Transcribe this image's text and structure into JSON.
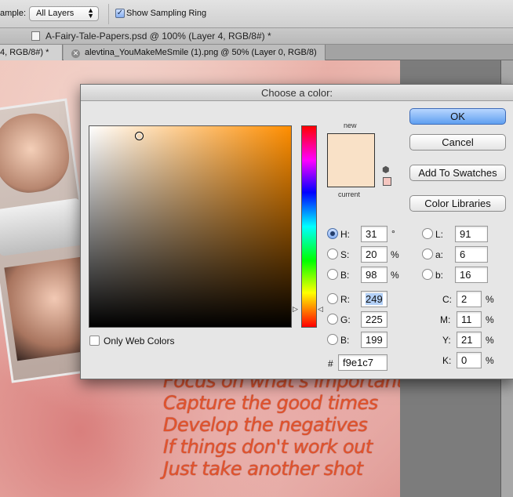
{
  "options_bar": {
    "sample_label": "ample:",
    "sample_value": "All Layers",
    "show_sampling_ring_checked": true,
    "show_sampling_ring_label": "Show Sampling Ring"
  },
  "documents": {
    "window_title": "A-Fairy-Tale-Papers.psd @ 100% (Layer 4, RGB/8#) *",
    "tab_active": "4, RGB/8#) *",
    "tab_other": "alevtina_YouMakeMeSmile (1).png @ 50% (Layer 0, RGB/8)"
  },
  "canvas": {
    "poem_lines": [
      "Focus on what's important",
      "Capture the good times",
      "Develop the negatives",
      "If things don't work out",
      "Just take another shot"
    ]
  },
  "dialog": {
    "title": "Choose a color:",
    "new_label": "new",
    "current_label": "current",
    "new_color": "#f9e1c7",
    "hue_channel": "H",
    "only_web_colors_label": "Only Web Colors",
    "buttons": {
      "ok": "OK",
      "cancel": "Cancel",
      "add_to_swatches": "Add To Swatches",
      "color_libraries": "Color Libraries"
    },
    "hsb": {
      "h_label": "H:",
      "h_value": "31",
      "h_unit": "°",
      "s_label": "S:",
      "s_value": "20",
      "s_unit": "%",
      "b_label": "B:",
      "b_value": "98",
      "b_unit": "%"
    },
    "rgb": {
      "r_label": "R:",
      "r_value": "249",
      "g_label": "G:",
      "g_value": "225",
      "b_label": "B:",
      "b_value": "199"
    },
    "lab": {
      "l_label": "L:",
      "l_value": "91",
      "a_label": "a:",
      "a_value": "6",
      "b_label": "b:",
      "b_value": "16"
    },
    "cmyk": {
      "c_label": "C:",
      "c_value": "2",
      "c_unit": "%",
      "m_label": "M:",
      "m_value": "11",
      "m_unit": "%",
      "y_label": "Y:",
      "y_value": "21",
      "y_unit": "%",
      "k_label": "K:",
      "k_value": "0",
      "k_unit": "%"
    },
    "hex_label": "#",
    "hex_value": "f9e1c7"
  }
}
